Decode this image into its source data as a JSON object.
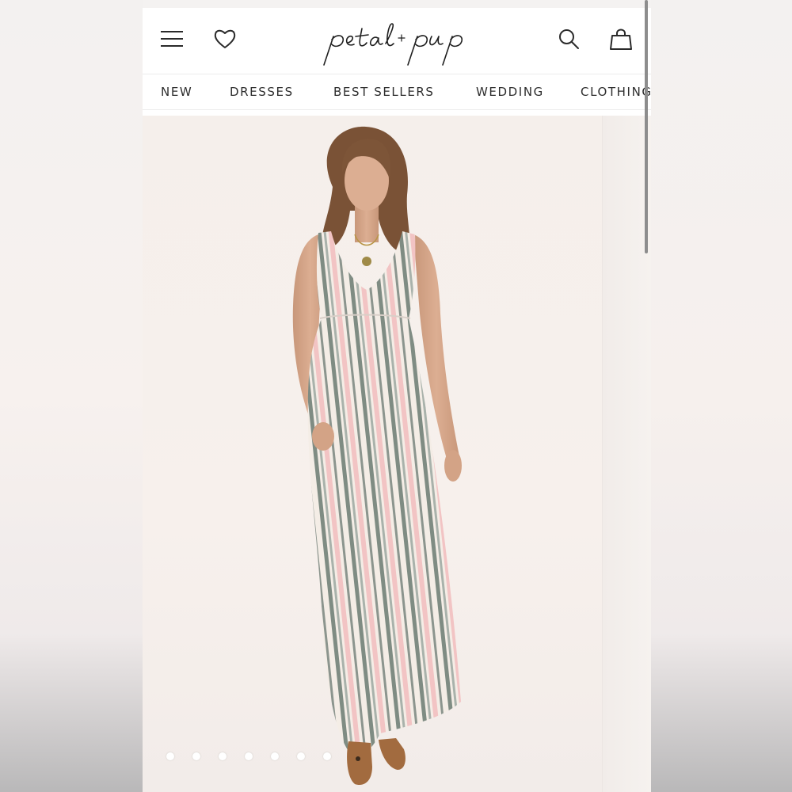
{
  "brand": {
    "logo_text": "petal + pup"
  },
  "header": {
    "icons": [
      "menu-icon",
      "heart-icon",
      "search-icon",
      "bag-icon"
    ]
  },
  "nav": {
    "items": [
      {
        "label": "NEW"
      },
      {
        "label": "DRESSES"
      },
      {
        "label": "BEST SELLERS"
      },
      {
        "label": "WEDDING"
      },
      {
        "label": "CLOTHING"
      }
    ]
  },
  "carousel": {
    "slide_count": 7,
    "active_index": 0
  },
  "colors": {
    "dress_pink": "#f2c4c4",
    "dress_sage": "#7f8c83",
    "dress_cream": "#f4ede6",
    "skin": "#d7a889",
    "hair": "#7a5236"
  }
}
